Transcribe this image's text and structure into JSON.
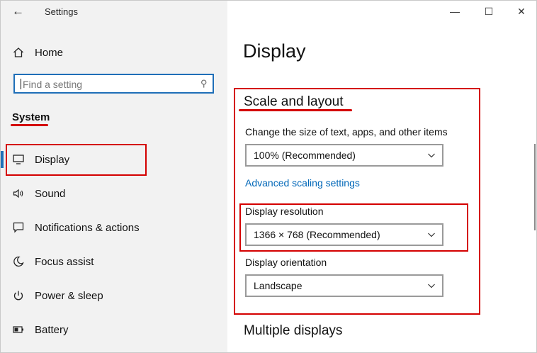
{
  "window": {
    "title": "Settings",
    "back_icon": "←",
    "minimize_icon": "—",
    "maximize_icon": "☐",
    "close_icon": "✕"
  },
  "sidebar": {
    "home": {
      "label": "Home",
      "icon": "home-icon"
    },
    "search": {
      "placeholder": "Find a setting",
      "icon": "search-icon"
    },
    "section_label": "System",
    "items": [
      {
        "label": "Display",
        "icon": "monitor-icon",
        "glyph": "▭",
        "selected": true
      },
      {
        "label": "Sound",
        "icon": "speaker-icon",
        "glyph": "🔈"
      },
      {
        "label": "Notifications & actions",
        "icon": "message-icon",
        "glyph": "▢"
      },
      {
        "label": "Focus assist",
        "icon": "moon-icon",
        "glyph": "☾"
      },
      {
        "label": "Power & sleep",
        "icon": "power-icon",
        "glyph": "⏻"
      },
      {
        "label": "Battery",
        "icon": "battery-icon",
        "glyph": "▭"
      }
    ]
  },
  "main": {
    "title": "Display",
    "scale_layout": {
      "heading": "Scale and layout",
      "scale_label": "Change the size of text, apps, and other items",
      "scale_value": "100% (Recommended)",
      "advanced_link": "Advanced scaling settings",
      "resolution_label": "Display resolution",
      "resolution_value": "1366 × 768 (Recommended)",
      "orientation_label": "Display orientation",
      "orientation_value": "Landscape"
    },
    "multiple_displays_heading": "Multiple displays"
  },
  "colors": {
    "accent": "#1f6fb8",
    "annotation_red": "#d40000",
    "link": "#0067b8",
    "sidebar_bg": "#f2f2f2"
  }
}
